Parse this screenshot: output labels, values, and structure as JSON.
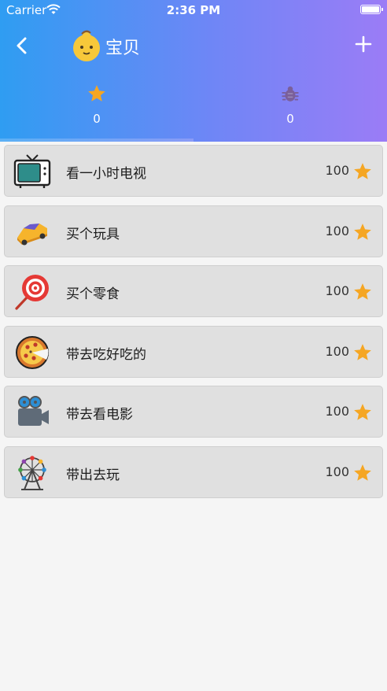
{
  "status_bar": {
    "carrier": "Carrier",
    "time": "2:36 PM"
  },
  "nav": {
    "title": "宝贝",
    "avatar_icon": "baby-face-icon"
  },
  "stats": {
    "stars": {
      "icon": "star-icon",
      "value": "0"
    },
    "bugs": {
      "icon": "bug-icon",
      "value": "0"
    }
  },
  "colors": {
    "header_start": "#2f9df2",
    "header_end": "#9b7cf6",
    "star": "#f5a623"
  },
  "rewards": [
    {
      "icon": "tv-icon",
      "label": "看一小时电视",
      "points": "100"
    },
    {
      "icon": "toy-car-icon",
      "label": "买个玩具",
      "points": "100"
    },
    {
      "icon": "lollipop-icon",
      "label": "买个零食",
      "points": "100"
    },
    {
      "icon": "pizza-icon",
      "label": "带去吃好吃的",
      "points": "100"
    },
    {
      "icon": "movie-camera-icon",
      "label": "带去看电影",
      "points": "100"
    },
    {
      "icon": "ferris-wheel-icon",
      "label": "带出去玩",
      "points": "100"
    }
  ]
}
